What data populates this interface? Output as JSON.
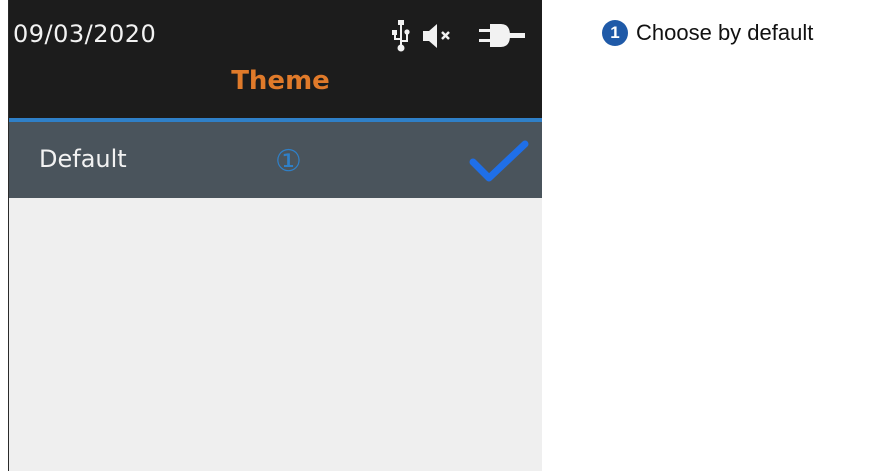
{
  "screen": {
    "date": "09/03/2020",
    "title": "Theme",
    "status_icons": [
      "usb-icon",
      "speaker-muted-icon",
      "power-plug-icon"
    ],
    "items": [
      {
        "label": "Default",
        "selected": true,
        "callout": "①"
      }
    ]
  },
  "legend": {
    "number": "1",
    "text": "Choose by default"
  },
  "colors": {
    "title": "#e07a2a",
    "accent": "#2f80c8",
    "check": "#1f6fe8",
    "legend_badge": "#1f5aa8",
    "header_bg": "#1c1c1c",
    "selected_row_bg": "#4a545c",
    "list_bg": "#efefef"
  }
}
